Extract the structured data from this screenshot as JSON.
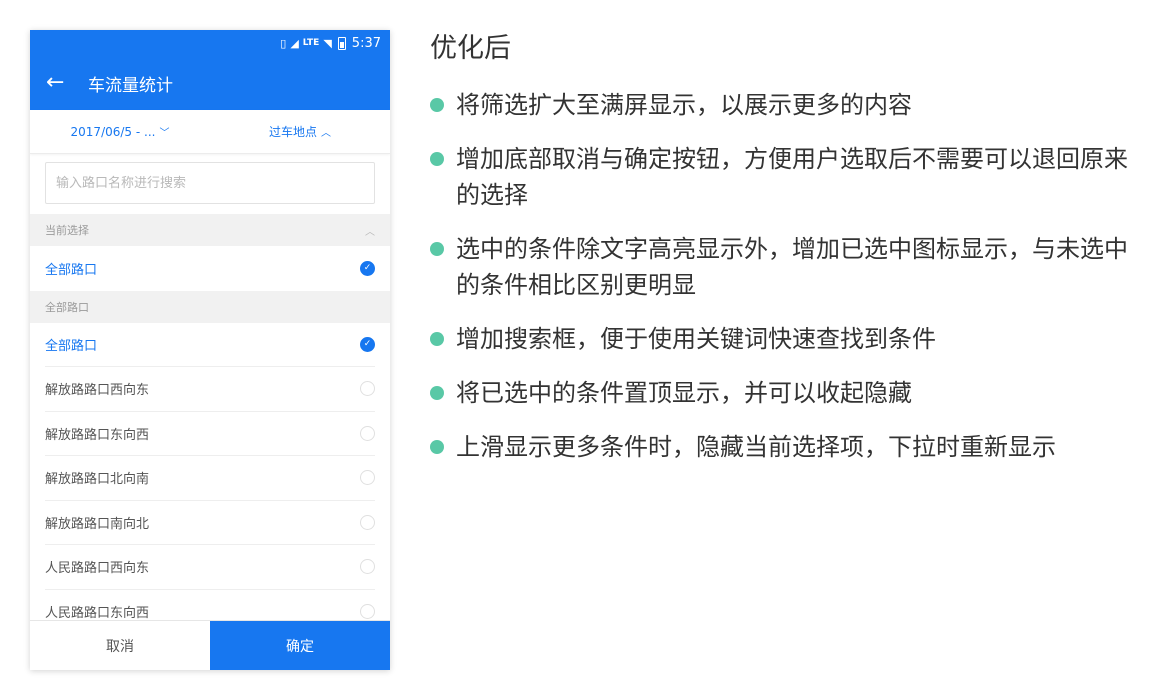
{
  "status_bar": {
    "time": "5:37",
    "network": "LTE"
  },
  "app_bar": {
    "title": "车流量统计"
  },
  "filters": [
    {
      "label": "2017/06/5 - ...",
      "chevron": "chevron-down-icon"
    },
    {
      "label": "过车地点",
      "chevron": "chevron-up-icon"
    }
  ],
  "search": {
    "placeholder": "输入路口名称进行搜索",
    "value": ""
  },
  "current_section": {
    "header": "当前选择",
    "items": [
      {
        "label": "全部路口",
        "checked": true
      }
    ]
  },
  "all_section": {
    "header": "全部路口",
    "items": [
      {
        "label": "全部路口",
        "checked": true
      },
      {
        "label": "解放路路口西向东",
        "checked": false
      },
      {
        "label": "解放路路口东向西",
        "checked": false
      },
      {
        "label": "解放路路口北向南",
        "checked": false
      },
      {
        "label": "解放路路口南向北",
        "checked": false
      },
      {
        "label": "人民路路口西向东",
        "checked": false
      },
      {
        "label": "人民路路口东向西",
        "checked": false
      }
    ]
  },
  "actions": {
    "cancel": "取消",
    "confirm": "确定"
  },
  "notes": {
    "title": "优化后",
    "items": [
      "将筛选扩大至满屏显示，以展示更多的内容",
      "增加底部取消与确定按钮，方便用户选取后不需要可以退回原来的选择",
      "选中的条件除文字高亮显示外，增加已选中图标显示，与未选中的条件相比区别更明显",
      "增加搜索框，便于使用关键词快速查找到条件",
      "将已选中的条件置顶显示，并可以收起隐藏",
      "上滑显示更多条件时，隐藏当前选择项，下拉时重新显示"
    ]
  },
  "colors": {
    "primary": "#1777f0",
    "bullet": "#59c8a6",
    "section_bg": "#f1f1f1"
  }
}
